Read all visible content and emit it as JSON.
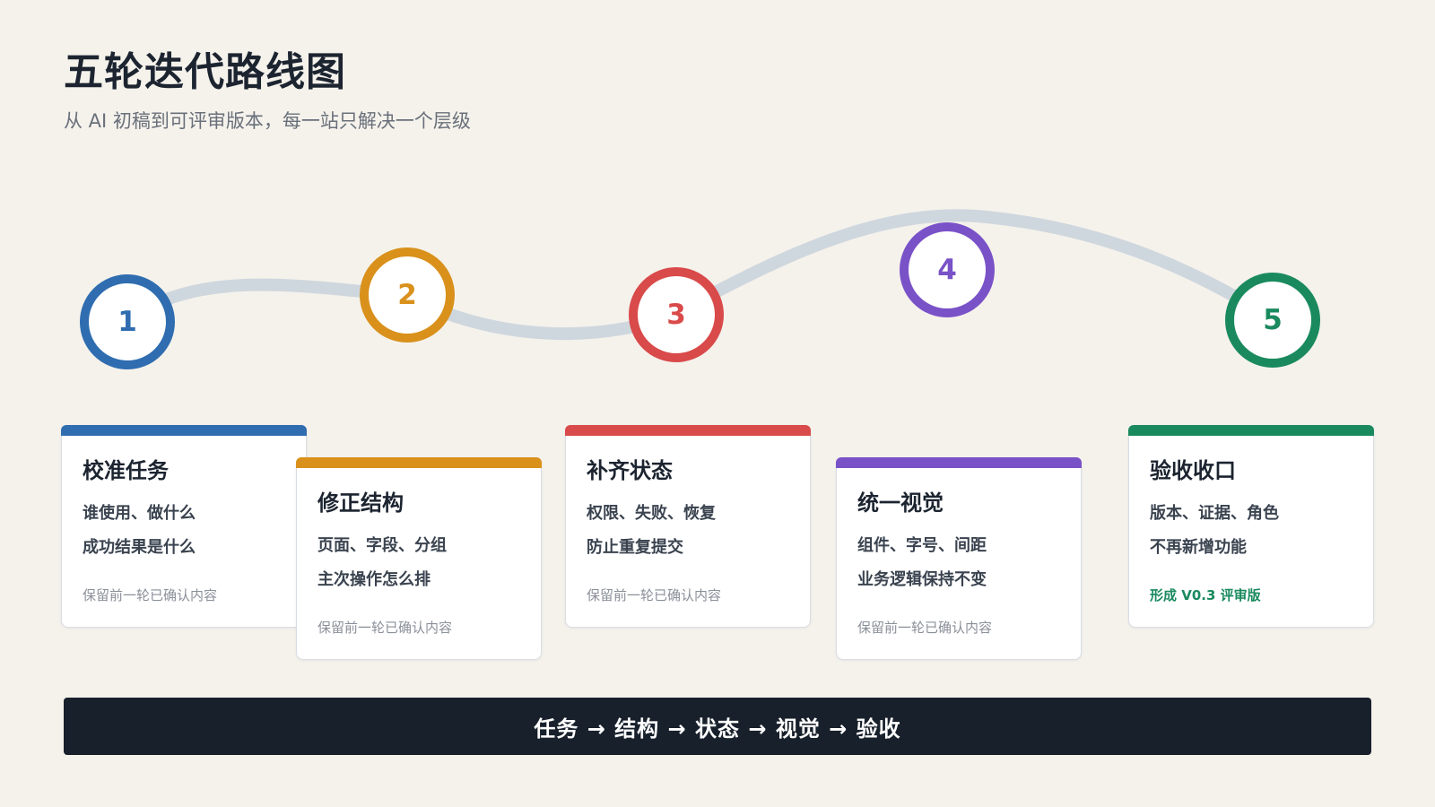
{
  "title": "五轮迭代路线图",
  "subtitle": "从 AI 初稿到可评审版本，每一站只解决一个层级",
  "path_color": "#cfd7de",
  "stages": [
    {
      "number": "1",
      "color": "#2f6db0",
      "title": "校准任务",
      "lines": [
        "谁使用、做什么",
        "成功结果是什么"
      ],
      "note": "保留前一轮已确认内容",
      "note_accent": false
    },
    {
      "number": "2",
      "color": "#d9911c",
      "title": "修正结构",
      "lines": [
        "页面、字段、分组",
        "主次操作怎么排"
      ],
      "note": "保留前一轮已确认内容",
      "note_accent": false
    },
    {
      "number": "3",
      "color": "#d94a4a",
      "title": "补齐状态",
      "lines": [
        "权限、失败、恢复",
        "防止重复提交"
      ],
      "note": "保留前一轮已确认内容",
      "note_accent": false
    },
    {
      "number": "4",
      "color": "#7a52c7",
      "title": "统一视觉",
      "lines": [
        "组件、字号、间距",
        "业务逻辑保持不变"
      ],
      "note": "保留前一轮已确认内容",
      "note_accent": false
    },
    {
      "number": "5",
      "color": "#1a8a5e",
      "title": "验收收口",
      "lines": [
        "版本、证据、角色",
        "不再新增功能"
      ],
      "note": "形成 V0.3 评审版",
      "note_accent": true
    }
  ],
  "footer": "任务 → 结构 → 状态 → 视觉 → 验收"
}
